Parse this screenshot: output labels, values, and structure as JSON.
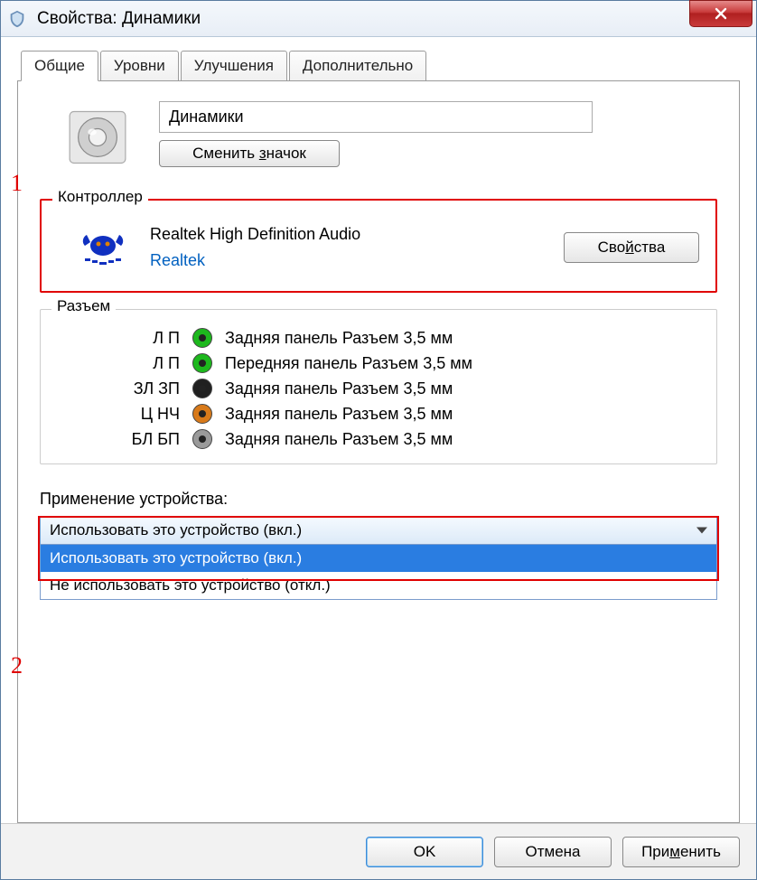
{
  "window": {
    "title": "Свойства: Динамики"
  },
  "tabs": [
    "Общие",
    "Уровни",
    "Улучшения",
    "Дополнительно"
  ],
  "device": {
    "name": "Динамики",
    "change_icon": "Сменить значок"
  },
  "annotations": {
    "num1": "1",
    "num2": "2"
  },
  "controller": {
    "group_title": "Контроллер",
    "name": "Realtek High Definition Audio",
    "vendor": "Realtek",
    "properties_btn": "Свойства"
  },
  "jacks": {
    "group_title": "Разъем",
    "items": [
      {
        "label": "Л П",
        "color": "#1db81d",
        "desc": "Задняя панель Разъем 3,5 мм"
      },
      {
        "label": "Л П",
        "color": "#1db81d",
        "desc": "Передняя панель Разъем 3,5 мм"
      },
      {
        "label": "ЗЛ ЗП",
        "color": "#202020",
        "desc": "Задняя панель Разъем 3,5 мм"
      },
      {
        "label": "Ц НЧ",
        "color": "#d87a1a",
        "desc": "Задняя панель Разъем 3,5 мм"
      },
      {
        "label": "БЛ БП",
        "color": "#9a9a9a",
        "desc": "Задняя панель Разъем 3,5 мм"
      }
    ]
  },
  "usage": {
    "label": "Применение устройства:",
    "selected": "Использовать это устройство (вкл.)",
    "options": [
      "Использовать это устройство (вкл.)",
      "Не использовать это устройство (откл.)"
    ]
  },
  "footer": {
    "ok": "OK",
    "cancel": "Отмена",
    "apply": "Применить"
  }
}
